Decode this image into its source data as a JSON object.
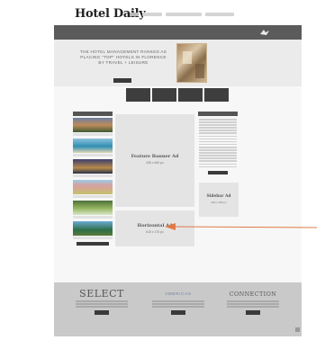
{
  "masthead": {
    "logo": "Hotel Daily"
  },
  "hero": {
    "headline": "THE HOTEL MANAGEMENT RANKED AS PLACING \"TOP\" HOTELS IN FLORENCE BY TRAVEL + LEISURE"
  },
  "main": {
    "feature_ad": {
      "title": "Feature Banner Ad",
      "size": "435 x 460 px"
    },
    "horizontal_ad": {
      "title": "Horizontal Ad",
      "size": "615 x 170 px"
    }
  },
  "sidebar": {
    "ad": {
      "title": "Sidebar Ad",
      "size": "300 x 250 px"
    }
  },
  "footer": {
    "brands": [
      {
        "name": "SELECT"
      },
      {
        "name": "AMERICAS"
      },
      {
        "name": "CONNECTION"
      }
    ]
  },
  "colors": {
    "promo_bar": "#5b5b5b",
    "nav_dark": "#3e3e3e",
    "ad_placeholder": "#e4e4e4",
    "footer_bg": "#c9c9c9",
    "arrow": "#e07a45"
  },
  "icons": {
    "promo_logo": "bird-logo-icon",
    "annotation": "arrow-icon"
  }
}
